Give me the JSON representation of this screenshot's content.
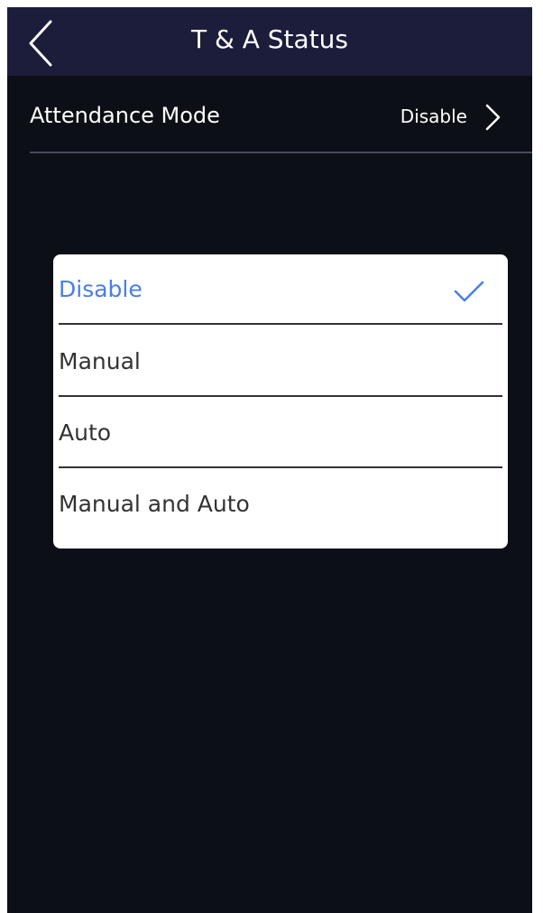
{
  "header": {
    "title": "T & A Status",
    "back_icon": "chevron-left-icon"
  },
  "setting": {
    "label": "Attendance Mode",
    "value": "Disable",
    "chevron_icon": "chevron-right-icon"
  },
  "dialog": {
    "options": [
      {
        "label": "Disable",
        "selected": true
      },
      {
        "label": "Manual",
        "selected": false
      },
      {
        "label": "Auto",
        "selected": false
      },
      {
        "label": "Manual and Auto",
        "selected": false
      }
    ],
    "check_icon": "checkmark-icon"
  },
  "colors": {
    "header_bg": "#1b1d3b",
    "screen_bg": "#0d0f17",
    "selected_text": "#4a7ee8",
    "option_text": "#333333",
    "divider": "#333333"
  }
}
